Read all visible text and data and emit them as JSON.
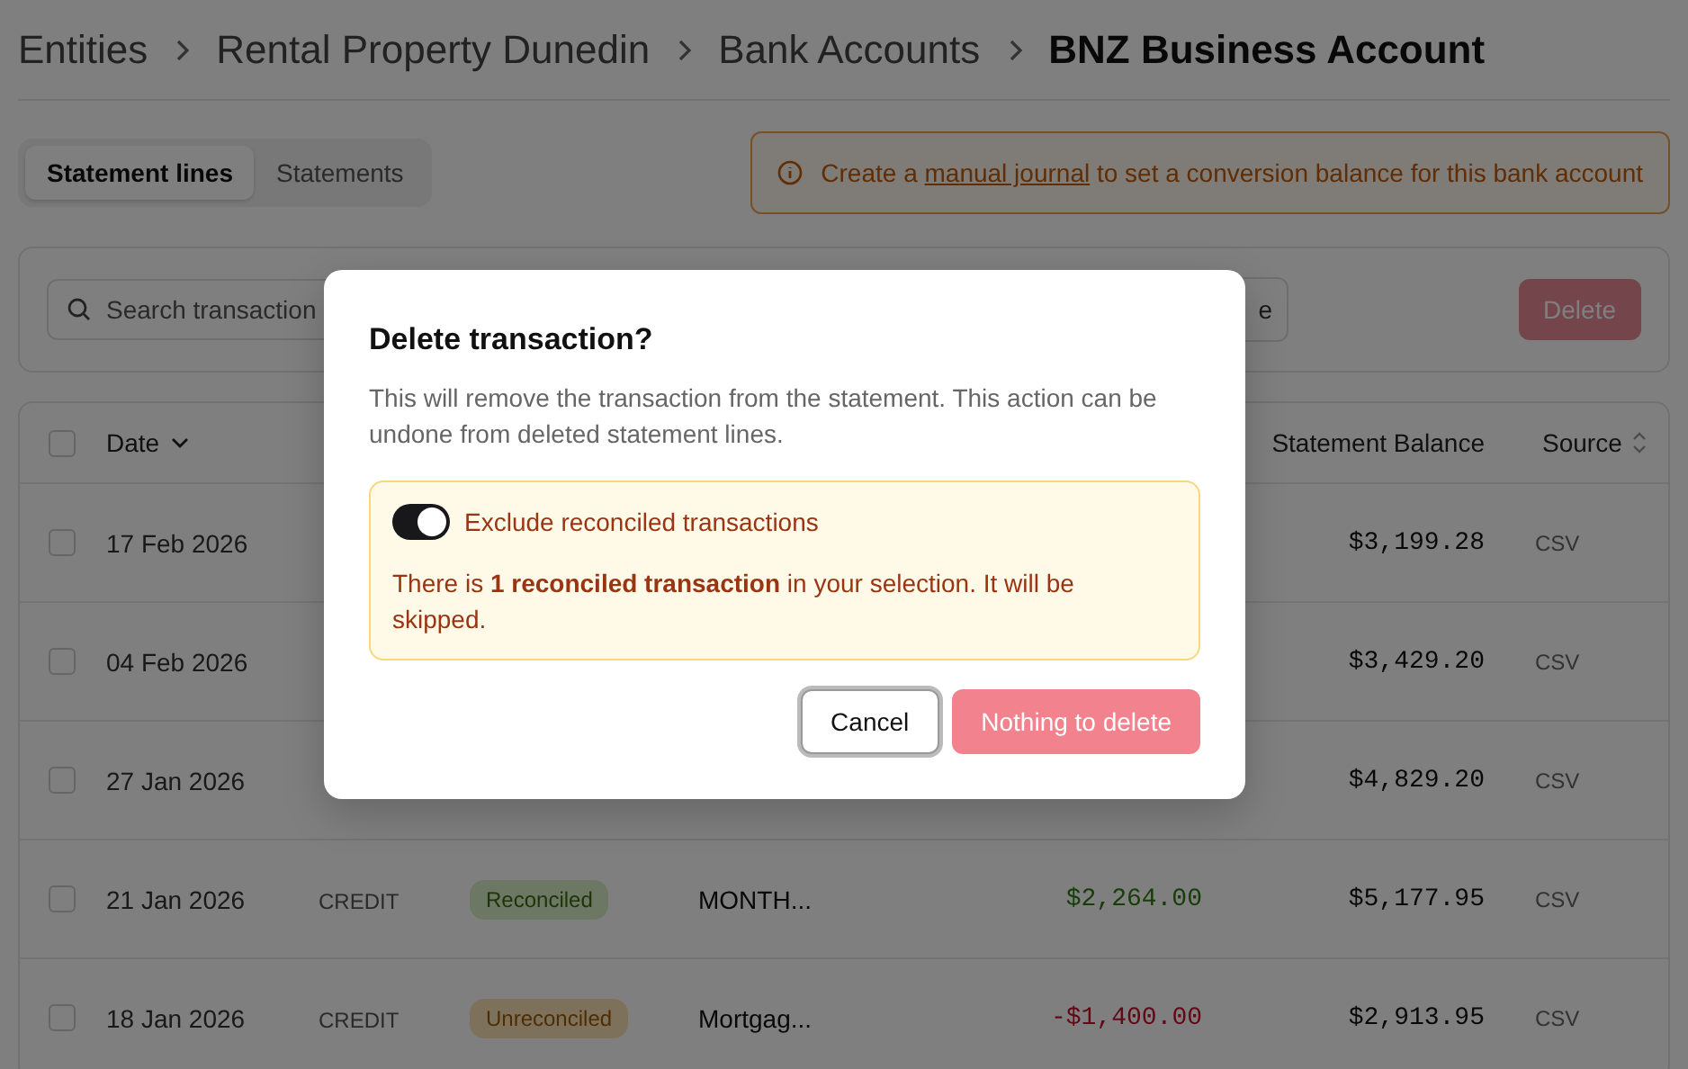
{
  "breadcrumb": [
    {
      "label": "Entities",
      "current": false
    },
    {
      "label": "Rental Property Dunedin",
      "current": false
    },
    {
      "label": "Bank Accounts",
      "current": false
    },
    {
      "label": "BNZ Business Account",
      "current": true
    }
  ],
  "tabs": [
    {
      "label": "Statement lines",
      "selected": true
    },
    {
      "label": "Statements",
      "selected": false
    }
  ],
  "notice": {
    "before": "Create a",
    "link": "manual journal",
    "after": "to set a conversion balance for this bank account"
  },
  "toolbar": {
    "search_placeholder": "Search transaction",
    "filter_text": "e",
    "delete_button": {
      "label": "Delete",
      "disabled": true
    }
  },
  "table": {
    "header_checked": false,
    "columns": [
      {
        "kind": "date",
        "label": "Date"
      },
      {
        "kind": "balance",
        "label": "Statement Balance"
      },
      {
        "kind": "source",
        "label": "Source"
      }
    ],
    "rows": [
      {
        "date": "17 Feb 2026",
        "balance": "$3,199.28",
        "source": "CSV",
        "checked": false
      },
      {
        "date": "04 Feb 2026",
        "balance": "$3,429.20",
        "source": "CSV",
        "checked": false
      },
      {
        "date": "27 Jan 2026",
        "balance": "$4,829.20",
        "source": "CSV",
        "checked": false
      },
      {
        "date": "21 Jan 2026",
        "type": "CREDIT",
        "status": {
          "kind": "reconciled",
          "label": "Reconciled"
        },
        "description": "MONTH...",
        "amount": {
          "kind": "credit",
          "text": "$2,264.00"
        },
        "balance": "$5,177.95",
        "source": "CSV",
        "checked": false
      },
      {
        "date": "18 Jan 2026",
        "type": "CREDIT",
        "status": {
          "kind": "unreconciled",
          "label": "Unreconciled"
        },
        "description": "Mortgag...",
        "amount": {
          "kind": "debit",
          "text": "-$1,400.00"
        },
        "balance": "$2,913.95",
        "source": "CSV",
        "checked": false
      }
    ]
  },
  "dialog": {
    "title": "Delete transaction?",
    "message": "This will remove the transaction from the statement. This action can be undone from deleted statement lines.",
    "toggle": {
      "label": "Exclude reconciled transactions",
      "on": true
    },
    "warning": "There is **1 reconciled transaction** in your selection. It will be skipped.",
    "buttons": [
      {
        "kind": "secondary",
        "label": "Cancel"
      },
      {
        "kind": "danger",
        "label": "Nothing to delete",
        "disabled": true
      }
    ]
  }
}
